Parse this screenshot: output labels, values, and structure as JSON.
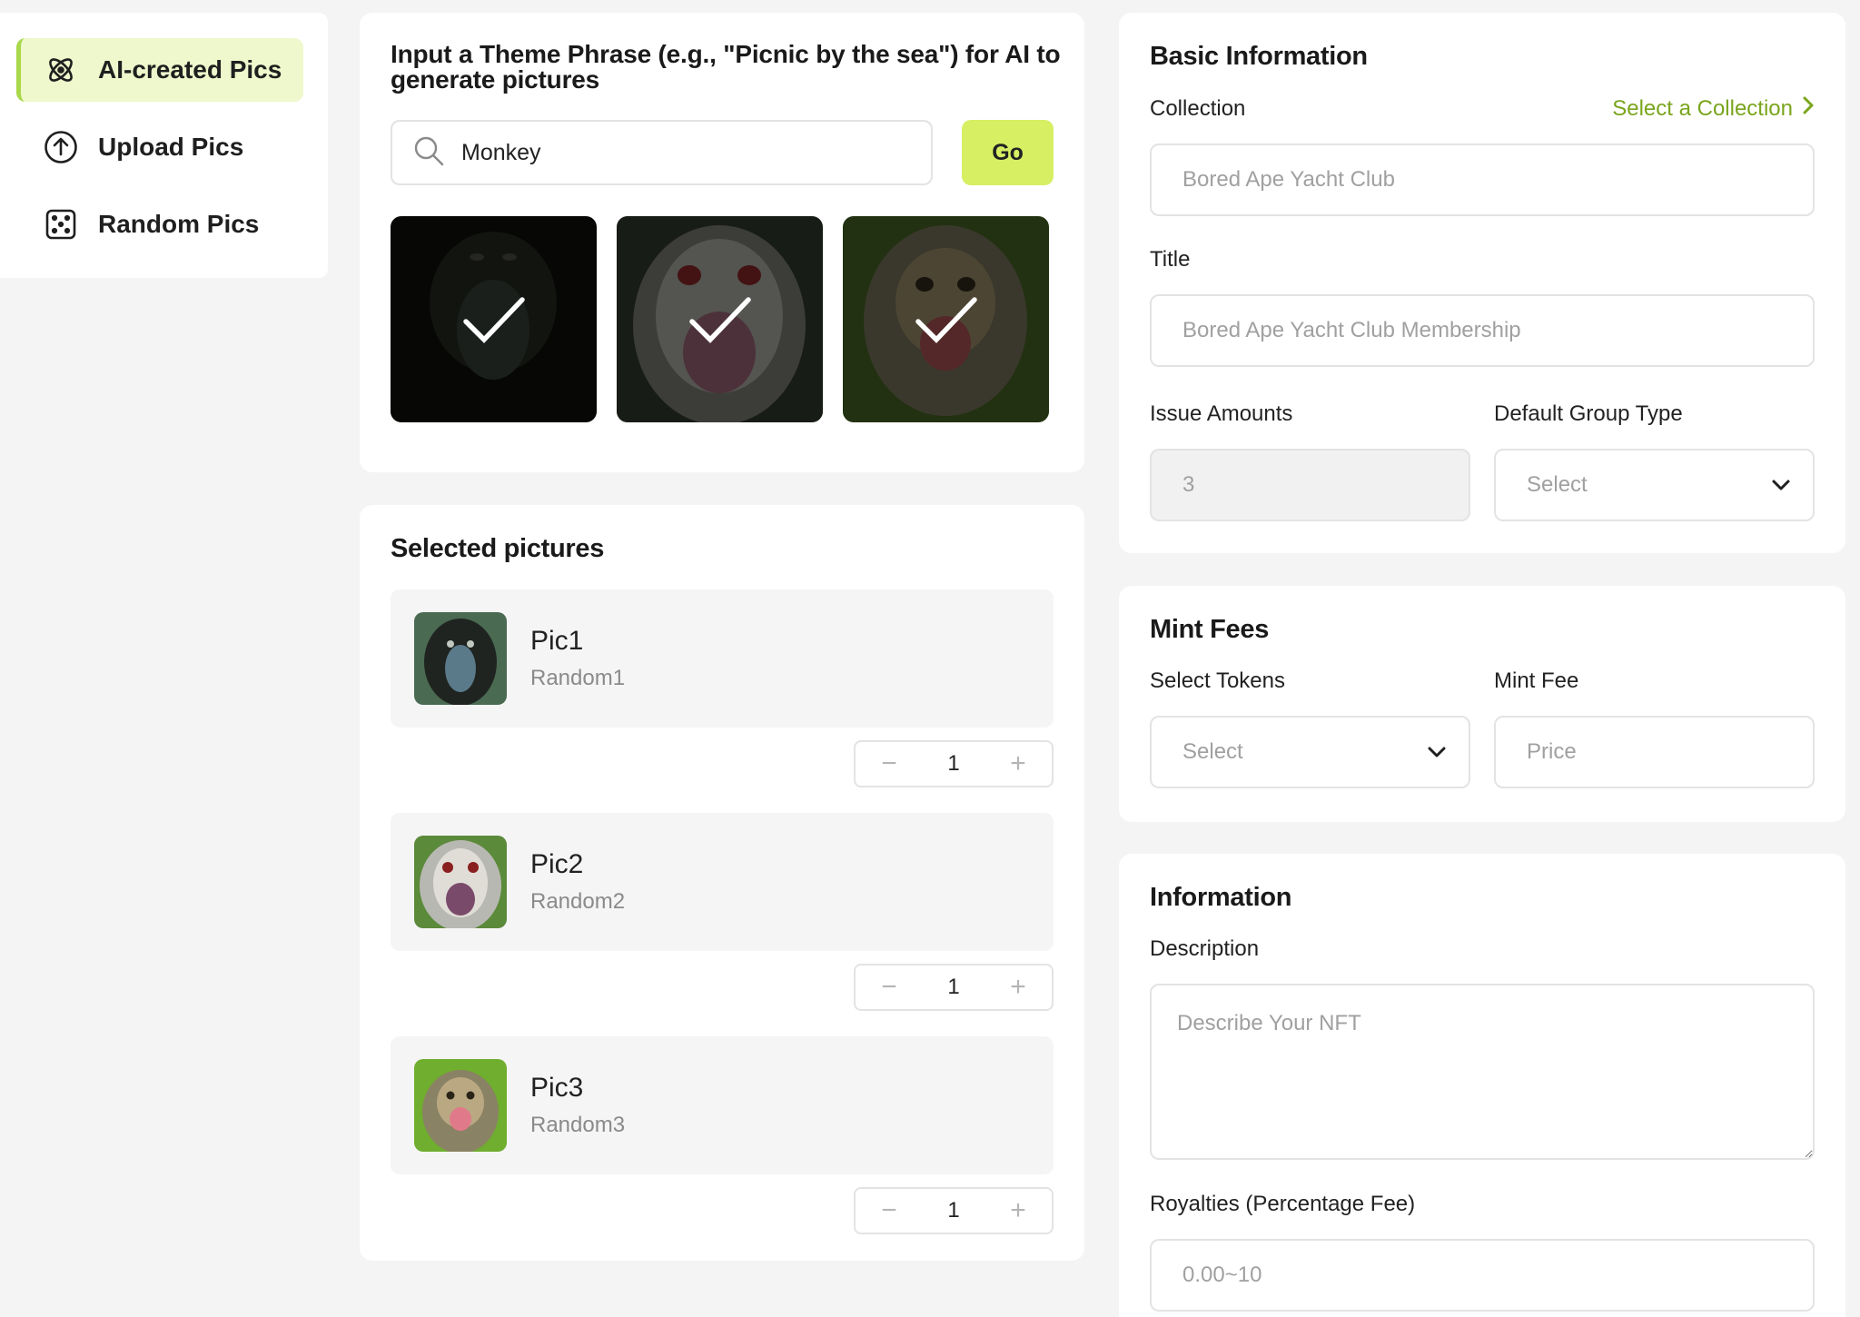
{
  "sidebar": {
    "items": [
      {
        "label": "AI-created Pics",
        "icon": "atom-icon",
        "active": true
      },
      {
        "label": "Upload Pics",
        "icon": "upload-icon",
        "active": false
      },
      {
        "label": "Random Pics",
        "icon": "dice-icon",
        "active": false
      }
    ]
  },
  "theme": {
    "prompt": "Input a Theme Phrase (e.g., \"Picnic by the sea\") for AI to generate pictures",
    "search_value": "Monkey",
    "go_label": "Go"
  },
  "selected": {
    "title": "Selected pictures",
    "items": [
      {
        "name": "Pic1",
        "sub": "Random1",
        "qty": "1"
      },
      {
        "name": "Pic2",
        "sub": "Random2",
        "qty": "1"
      },
      {
        "name": "Pic3",
        "sub": "Random3",
        "qty": "1"
      }
    ]
  },
  "basic": {
    "title": "Basic Information",
    "collection_label": "Collection",
    "collection_link": "Select a Collection",
    "collection_value": "Bored Ape Yacht Club",
    "title_label": "Title",
    "title_value": "Bored Ape Yacht Club Membership",
    "issue_label": "Issue Amounts",
    "issue_value": "3",
    "group_label": "Default Group Type",
    "group_value": "Select"
  },
  "fees": {
    "title": "Mint Fees",
    "tokens_label": "Select Tokens",
    "tokens_value": "Select",
    "fee_label": "Mint Fee",
    "fee_placeholder": "Price"
  },
  "info": {
    "title": "Information",
    "desc_label": "Description",
    "desc_placeholder": "Describe Your NFT",
    "royalties_label": "Royalties (Percentage Fee)",
    "royalties_placeholder": "0.00~10"
  },
  "colors": {
    "accent": "#d6ef63",
    "accent_link": "#7aa51d",
    "active_bg": "#eef8cc"
  }
}
